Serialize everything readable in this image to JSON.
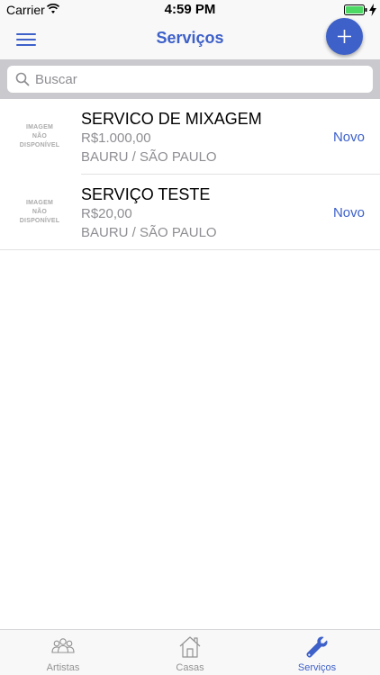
{
  "status_bar": {
    "carrier": "Carrier",
    "time": "4:59 PM",
    "battery_color": "#4cd964"
  },
  "nav": {
    "title": "Serviços",
    "accent_color": "#3d60c9",
    "menu_icon": "hamburger-icon",
    "add_icon": "plus-icon"
  },
  "search": {
    "placeholder": "Buscar",
    "value": ""
  },
  "items": [
    {
      "image_text": [
        "IMAGEM",
        "NÃO",
        "DISPONÍVEL"
      ],
      "title": "SERVICO DE MIXAGEM",
      "price": "R$1.000,00",
      "location": "BAURU / SÃO PAULO",
      "status": "Novo"
    },
    {
      "image_text": [
        "IMAGEM",
        "NÃO",
        "DISPONÍVEL"
      ],
      "title": "SERVIÇO TESTE",
      "price": "R$20,00",
      "location": "BAURU / SÃO PAULO",
      "status": "Novo"
    }
  ],
  "tabs": [
    {
      "label": "Artistas",
      "icon": "people-icon",
      "active": false
    },
    {
      "label": "Casas",
      "icon": "house-icon",
      "active": false
    },
    {
      "label": "Serviços",
      "icon": "wrench-icon",
      "active": true
    }
  ]
}
